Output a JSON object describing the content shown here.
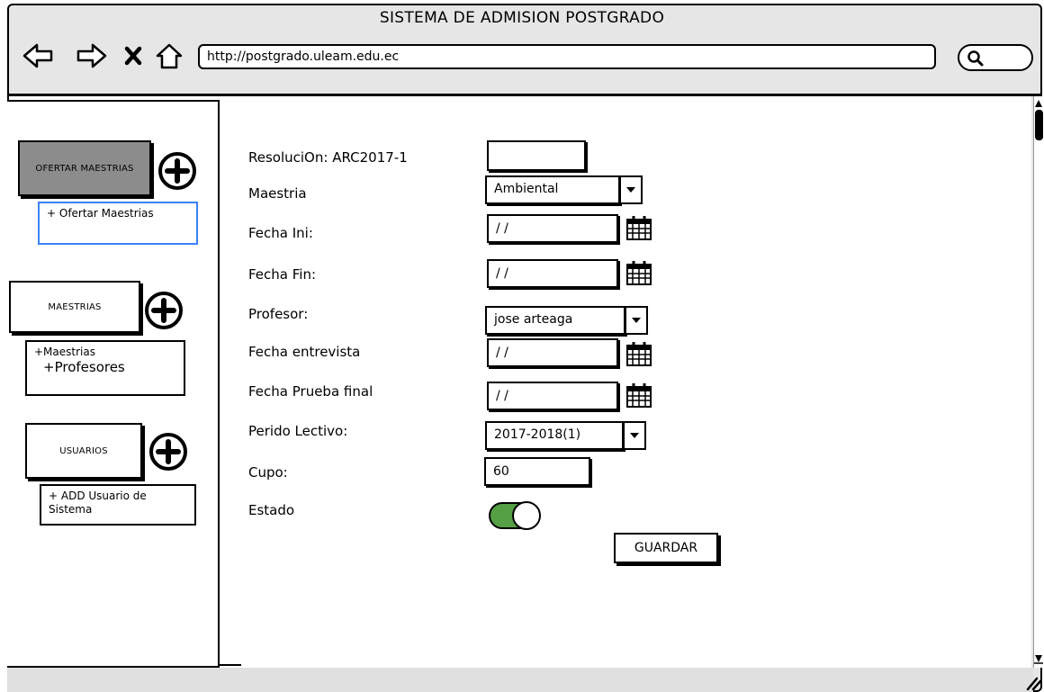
{
  "browser": {
    "title": "SISTEMA DE ADMISION POSTGRADO",
    "url": "http://postgrado.uleam.edu.ec",
    "nav_icons": [
      "back-arrow-icon",
      "forward-arrow-icon",
      "close-x-icon",
      "home-icon"
    ],
    "search_icon": "magnifier-icon"
  },
  "sidebar": {
    "sections": [
      {
        "label": "OFERTAR MAESTRIAS",
        "active": true,
        "icon": "plus-circle-icon",
        "items": [
          "+ Ofertar Maestrias"
        ]
      },
      {
        "label": "MAESTRIAS",
        "active": false,
        "icon": "plus-circle-icon",
        "items": [
          "+Maestrias",
          "+Profesores"
        ]
      },
      {
        "label": "USUARIOS",
        "active": false,
        "icon": "plus-circle-icon",
        "items": [
          "+ ADD Usuario de Sistema"
        ]
      }
    ]
  },
  "form": {
    "resolucion": {
      "label": "ResoluciOn: ARC2017-1",
      "value": ""
    },
    "maestria": {
      "label": "Maestria",
      "value": "Ambiental"
    },
    "fecha_ini": {
      "label": "Fecha Ini:",
      "value": "/ /"
    },
    "fecha_fin": {
      "label": "Fecha Fin:",
      "value": "/ /"
    },
    "profesor": {
      "label": "Profesor:",
      "value": "jose arteaga"
    },
    "fecha_entrevista": {
      "label": "Fecha entrevista",
      "value": "/ /"
    },
    "fecha_prueba": {
      "label": "Fecha Prueba final",
      "value": "/ /"
    },
    "periodo": {
      "label": "Perido Lectivo:",
      "value": "2017-2018(1)"
    },
    "cupo": {
      "label": "Cupo:",
      "value": "60"
    },
    "estado": {
      "label": "Estado",
      "on": true
    },
    "save_label": "GUARDAR"
  },
  "colors": {
    "active_section": "#8c8c8c",
    "selected_item_border": "#3b82f6",
    "toggle_on": "#55a044",
    "chrome": "#e6e6e6"
  }
}
